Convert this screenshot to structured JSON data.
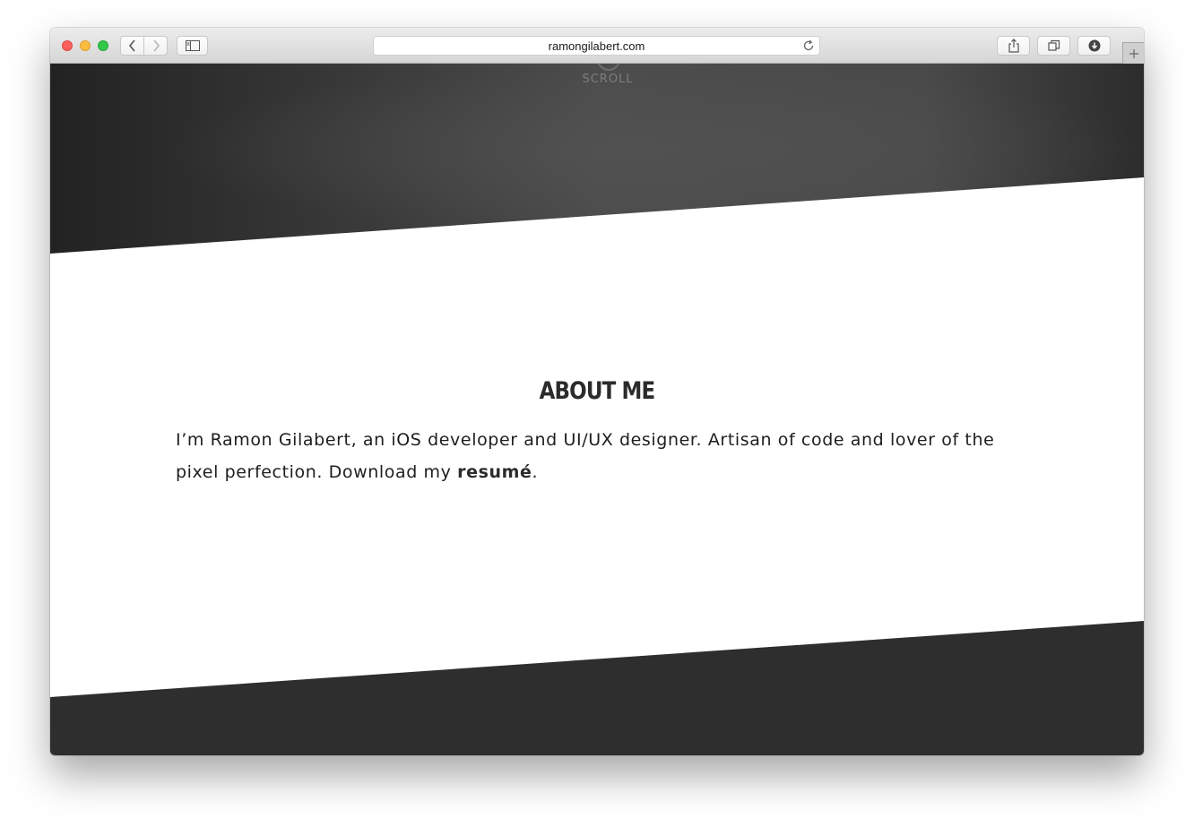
{
  "browser": {
    "url": "ramongilabert.com",
    "buttons": [
      "back",
      "forward",
      "sidebar",
      "share",
      "tabs",
      "downloads",
      "new-tab"
    ]
  },
  "hero": {
    "scroll_label": "SCROLL"
  },
  "about": {
    "title": "ABOUT ME",
    "text_before": "I’m Ramon Gilabert, an iOS developer and UI/UX designer. Artisan of code and lover of the pixel perfection. Download my ",
    "resume_link": "resumé",
    "text_after": "."
  },
  "colors": {
    "hero_dark": "#2a2a2a",
    "footer_dark": "#2e2e2e",
    "text": "#1e1e1e"
  }
}
